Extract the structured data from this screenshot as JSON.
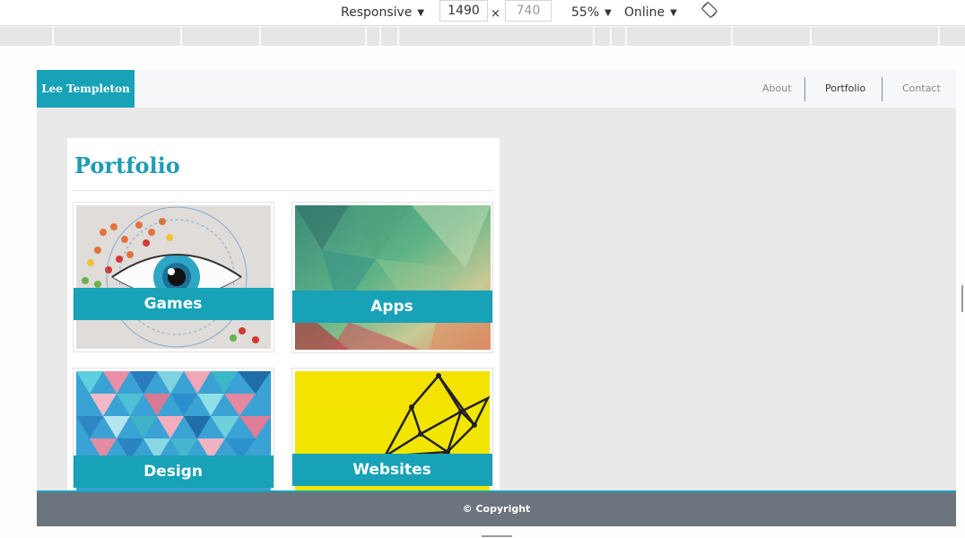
{
  "devtools": {
    "device": "Responsive",
    "width": "1490",
    "height": "740",
    "times": "×",
    "zoom": "55%",
    "network": "Online",
    "caret": "▼"
  },
  "page": {
    "brand": "Lee Templeton",
    "nav": [
      {
        "label": "About"
      },
      {
        "label": "Portfolio",
        "active": true
      },
      {
        "label": "Contact"
      }
    ],
    "section_title": "Portfolio",
    "tiles": [
      {
        "label": "Games"
      },
      {
        "label": "Apps"
      },
      {
        "label": "Design"
      },
      {
        "label": "Websites"
      }
    ],
    "footer": "© Copyright"
  },
  "colors": {
    "accent": "#17a2b8",
    "title": "#1f9db3",
    "footer": "#6c757d",
    "page_bg": "#e9e9e9"
  }
}
